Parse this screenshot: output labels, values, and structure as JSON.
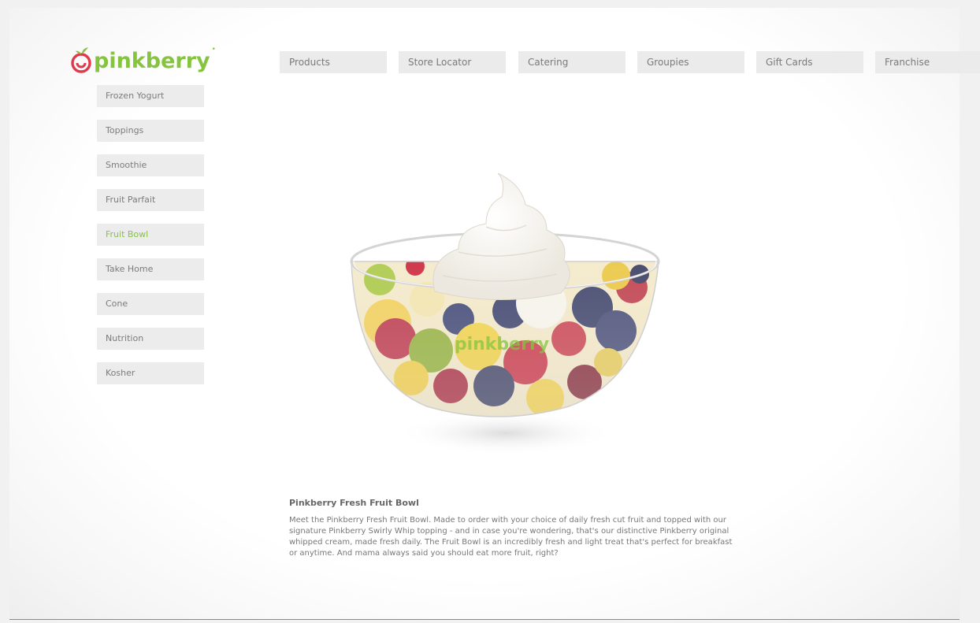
{
  "brand": {
    "name": "pinkberry",
    "primary_color": "#86c440",
    "accent_color": "#e0394d"
  },
  "top_nav": [
    {
      "label": "Products",
      "name": "nav-products"
    },
    {
      "label": "Store Locator",
      "name": "nav-store-locator"
    },
    {
      "label": "Catering",
      "name": "nav-catering"
    },
    {
      "label": "Groupies",
      "name": "nav-groupies"
    },
    {
      "label": "Gift Cards",
      "name": "nav-gift-cards"
    },
    {
      "label": "Franchise",
      "name": "nav-franchise"
    }
  ],
  "sidebar": [
    {
      "label": "Frozen Yogurt"
    },
    {
      "label": "Toppings"
    },
    {
      "label": "Smoothie"
    },
    {
      "label": "Fruit Parfait"
    },
    {
      "label": "Fruit Bowl",
      "active": true
    },
    {
      "label": "Take Home"
    },
    {
      "label": "Cone"
    },
    {
      "label": "Nutrition"
    },
    {
      "label": "Kosher"
    }
  ],
  "product": {
    "image_label": "pinkberry",
    "title": "Pinkberry Fresh Fruit Bowl",
    "description": "Meet the Pinkberry Fresh Fruit Bowl. Made to order with your choice of daily fresh cut fruit and topped with our signature Pinkberry Swirly Whip topping - and in case you're wondering, that's our distinctive Pinkberry original whipped cream, made fresh daily. The Fruit Bowl is an incredibly fresh and light treat that's perfect for breakfast or anytime. And mama always said you should eat more fruit, right?"
  }
}
